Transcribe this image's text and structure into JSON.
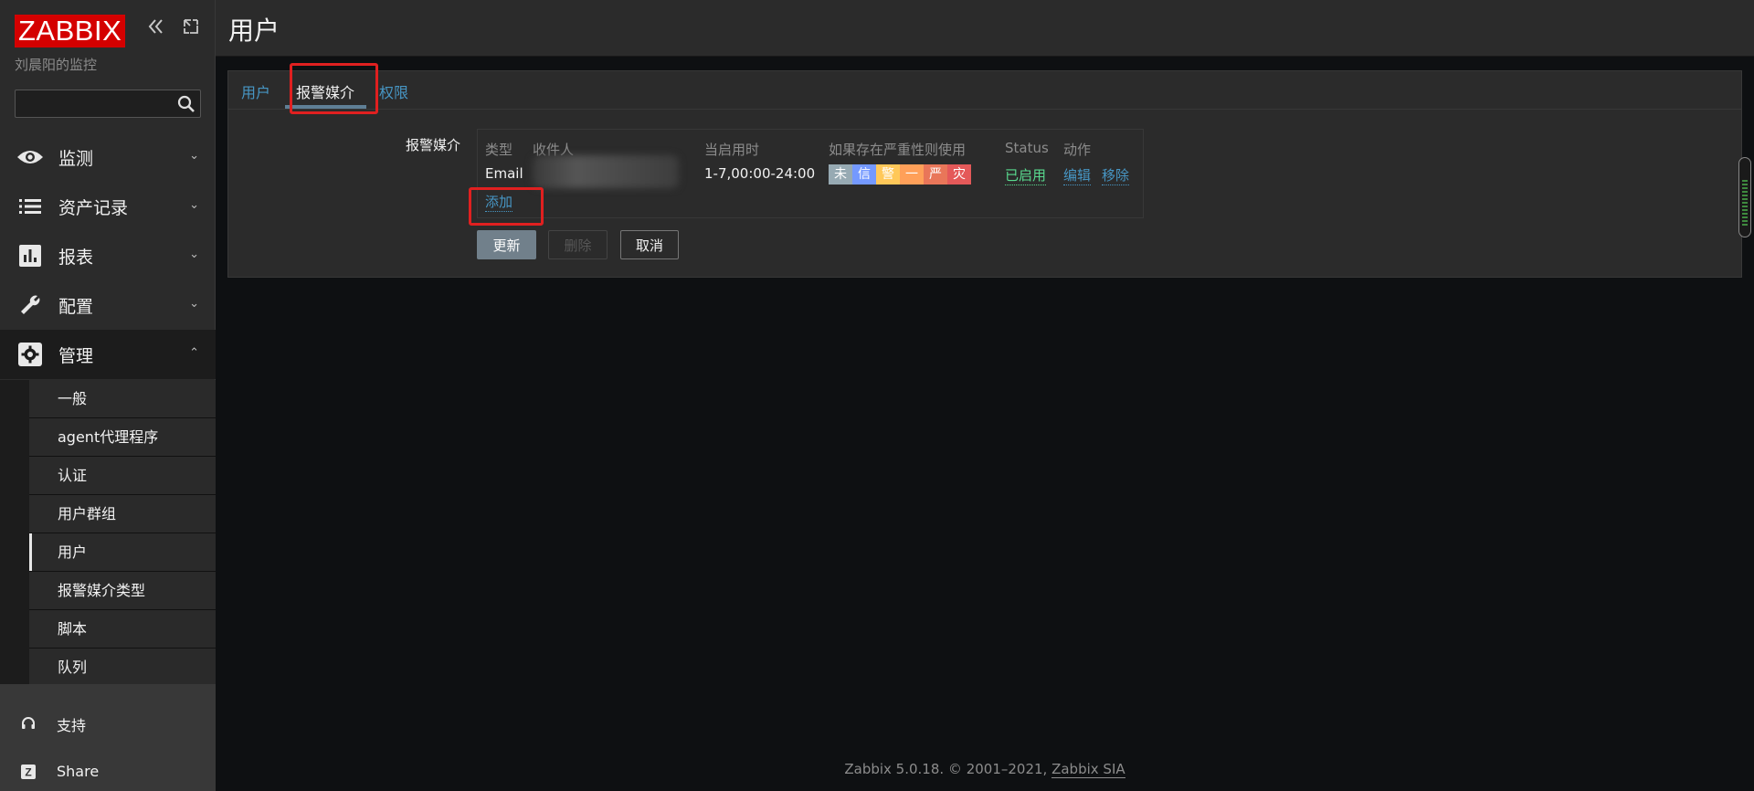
{
  "sidebar": {
    "logo": "ZABBIX",
    "server_name": "刘晨阳的监控",
    "search_placeholder": "",
    "menu": [
      {
        "label": "监测",
        "icon": "eye-icon",
        "chevron": "⌄"
      },
      {
        "label": "资产记录",
        "icon": "list-icon",
        "chevron": "⌄"
      },
      {
        "label": "报表",
        "icon": "bar-chart-icon",
        "chevron": "⌄"
      },
      {
        "label": "配置",
        "icon": "wrench-icon",
        "chevron": "⌄"
      },
      {
        "label": "管理",
        "icon": "gear-icon",
        "chevron": "⌃"
      }
    ],
    "submenu": [
      "一般",
      "agent代理程序",
      "认证",
      "用户群组",
      "用户",
      "报警媒介类型",
      "脚本",
      "队列"
    ],
    "bottom": [
      {
        "label": "支持",
        "icon": "headset-icon"
      },
      {
        "label": "Share",
        "icon": "share-icon"
      }
    ]
  },
  "header": {
    "title": "用户"
  },
  "tabs": [
    "用户",
    "报警媒介",
    "权限"
  ],
  "form": {
    "field_label": "报警媒介",
    "columns": [
      "类型",
      "收件人",
      "当启用时",
      "如果存在严重性则使用",
      "Status",
      "动作"
    ],
    "row": {
      "type": "Email",
      "when_active": "1-7,00:00-24:00",
      "severities": [
        {
          "label": "未",
          "color": "#97aab3"
        },
        {
          "label": "信",
          "color": "#7499ff"
        },
        {
          "label": "警",
          "color": "#ffc859"
        },
        {
          "label": "一",
          "color": "#ffa059"
        },
        {
          "label": "严",
          "color": "#e97659"
        },
        {
          "label": "灾",
          "color": "#e45959"
        }
      ],
      "status": "已启用",
      "edit": "编辑",
      "remove": "移除"
    },
    "add_link": "添加",
    "buttons": {
      "update": "更新",
      "delete": "删除",
      "cancel": "取消"
    }
  },
  "footer": {
    "text": "Zabbix 5.0.18. © 2001–2021, ",
    "link": "Zabbix SIA"
  }
}
